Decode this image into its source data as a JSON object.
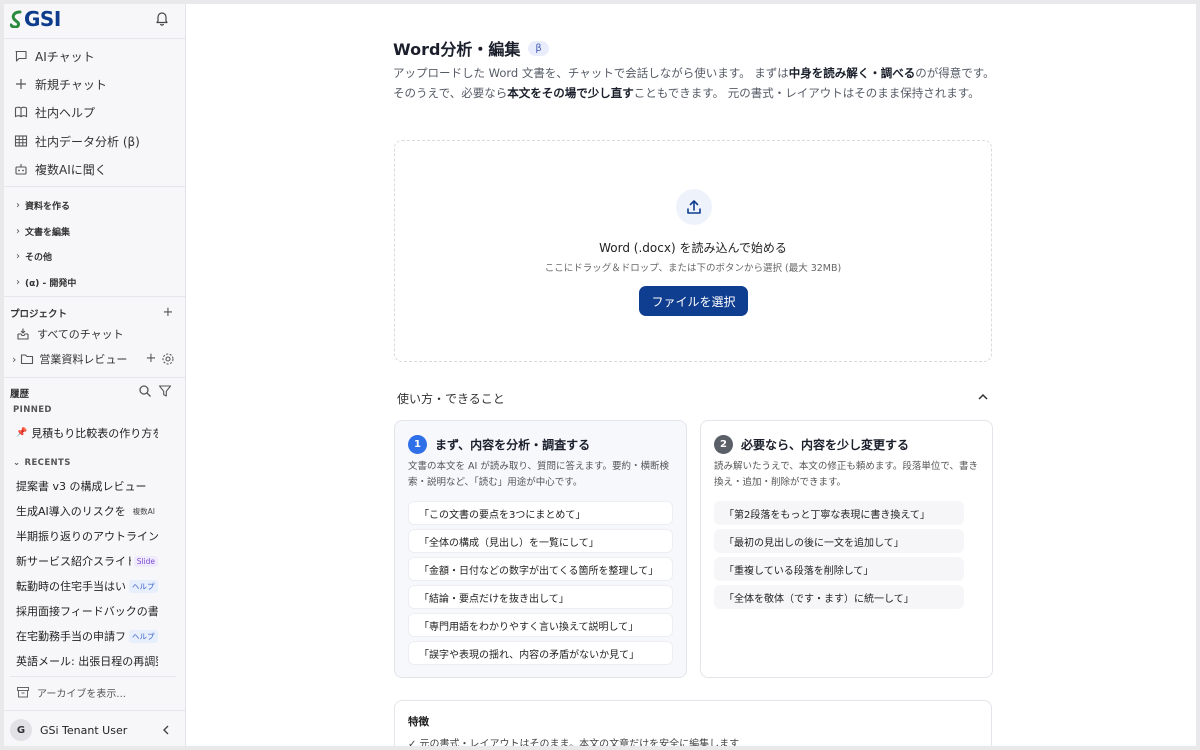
{
  "brand": {
    "logo_text": "GSI",
    "accent": "#0f3d8f"
  },
  "sidebar": {
    "nav": [
      {
        "label": "AIチャット",
        "icon": "chat-icon"
      },
      {
        "label": "新規チャット",
        "icon": "plus-icon"
      },
      {
        "label": "社内ヘルプ",
        "icon": "book-icon"
      },
      {
        "label": "社内データ分析 (β)",
        "icon": "table-icon"
      },
      {
        "label": "複数AIに聞く",
        "icon": "robot-icon"
      }
    ],
    "groups": [
      "資料を作る",
      "文書を編集",
      "その他",
      "(α) - 開発中"
    ],
    "projects_title": "プロジェクト",
    "all_chats": "すべてのチャット",
    "project_folder": "営業資料レビュー",
    "history_title": "履歴",
    "pinned_label": "PINNED",
    "pinned_items": [
      {
        "label": "見積もり比較表の作り方を!"
      }
    ],
    "recents_label": "RECENTS",
    "recents": [
      {
        "label": "提案書 v3 の構成レビュー",
        "badge": ""
      },
      {
        "label": "生成AI導入のリスクを!",
        "badge": "複数AI"
      },
      {
        "label": "半期振り返りのアウトライン行",
        "badge": ""
      },
      {
        "label": "新サービス紹介スライド",
        "badge": "Slide"
      },
      {
        "label": "転勤時の住宅手当はい",
        "badge": "ヘルプ"
      },
      {
        "label": "採用面接フィードバックの書き",
        "badge": ""
      },
      {
        "label": "在宅勤務手当の申請フ",
        "badge": "ヘルプ"
      },
      {
        "label": "英語メール: 出張日程の再調整",
        "badge": ""
      }
    ],
    "archive_label": "アーカイブを表示...",
    "user": {
      "initial": "G",
      "name": "GSi Tenant User"
    }
  },
  "main": {
    "title": "Word分析・編集",
    "beta_badge": "β",
    "desc_1": "アップロードした Word 文書を、チャットで会話しながら使います。 まずは",
    "desc_b1": "中身を読み解く・調べる",
    "desc_2": "のが得意です。 そのうえで、必要なら",
    "desc_b2": "本文をその場で少し直す",
    "desc_3": "こともできます。 元の書式・レイアウトはそのまま保持されます。",
    "drop": {
      "title": "Word (.docx) を読み込んで始める",
      "sub": "ここにドラッグ＆ドロップ、または下のボタンから選択 (最大 32MB)",
      "button": "ファイルを選択"
    },
    "howto_title": "使い方・できること",
    "card1": {
      "num": "1",
      "title": "まず、内容を分析・調査する",
      "desc": "文書の本文を AI が読み取り、質問に答えます。要約・横断検索・説明など、「読む」用途が中心です。",
      "examples": [
        "「この文書の要点を3つにまとめて」",
        "「全体の構成（見出し）を一覧にして」",
        "「金額・日付などの数字が出てくる箇所を整理して」",
        "「結論・要点だけを抜き出して」",
        "「専門用語をわかりやすく言い換えて説明して」",
        "「誤字や表現の揺れ、内容の矛盾がないか見て」"
      ]
    },
    "card2": {
      "num": "2",
      "title": "必要なら、内容を少し変更する",
      "desc": "読み解いたうえで、本文の修正も頼めます。段落単位で、書き換え・追加・削除ができます。",
      "examples": [
        "「第2段落をもっと丁寧な表現に書き換えて」",
        "「最初の見出しの後に一文を追加して」",
        "「重複している段落を削除して」",
        "「全体を敬体（です・ます）に統一して」"
      ]
    },
    "features_title": "特徴",
    "features": [
      "✓ 元の書式・レイアウトはそのまま。本文の文章だけを安全に編集します"
    ]
  }
}
